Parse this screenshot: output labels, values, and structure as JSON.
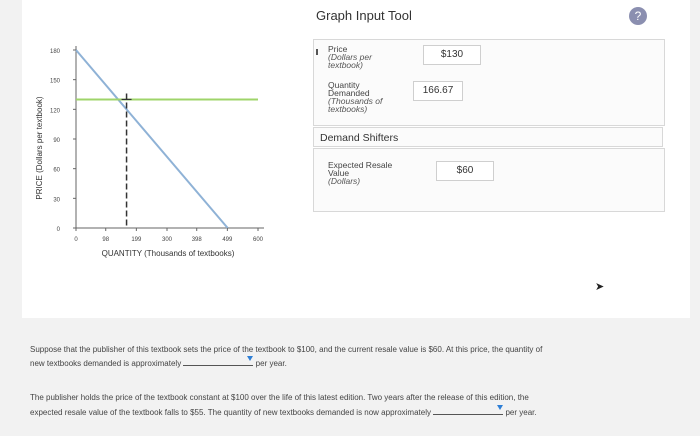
{
  "tool": {
    "title": "Graph Input Tool",
    "help_label": "?"
  },
  "chart_data": {
    "type": "line",
    "xlabel": "QUANTITY (Thousands of textbooks)",
    "ylabel": "PRICE (Dollars per textbook)",
    "x_ticks": [
      0,
      98,
      199,
      300,
      398,
      499,
      600
    ],
    "y_ticks": [
      0,
      30,
      60,
      90,
      120,
      150,
      180
    ],
    "xlim": [
      0,
      600
    ],
    "ylim": [
      0,
      180
    ],
    "demand_curve": [
      [
        0,
        180
      ],
      [
        500,
        0
      ]
    ],
    "price_line": 130,
    "quantity_line": 166.67,
    "colors": {
      "demand": "#8fb2d6",
      "price": "#9fd46a",
      "quantity": "#333333"
    }
  },
  "inputs": {
    "price_label": "Price",
    "price_unit": "(Dollars per textbook)",
    "price_value": "$130",
    "quantity_label": "Quantity Demanded",
    "quantity_unit": "(Thousands of textbooks)",
    "quantity_value": "166.67",
    "shifters_title": "Demand Shifters",
    "resale_label": "Expected Resale Value",
    "resale_unit": "(Dollars)",
    "resale_value": "$60"
  },
  "questions": {
    "q1_before": "Suppose that the publisher of this textbook sets the price of the textbook to $100, and the current resale value is $60. At this price, the quantity of",
    "q1_line2": "new textbooks demanded is approximately",
    "q1_after": "per year.",
    "q2_line1": "The publisher holds the price of the textbook constant at $100 over the life of this latest edition. Two years after the release of this edition, the",
    "q2_line2": "expected resale value of the textbook falls to $55. The quantity of new textbooks demanded is now approximately",
    "q2_after": "per year."
  }
}
